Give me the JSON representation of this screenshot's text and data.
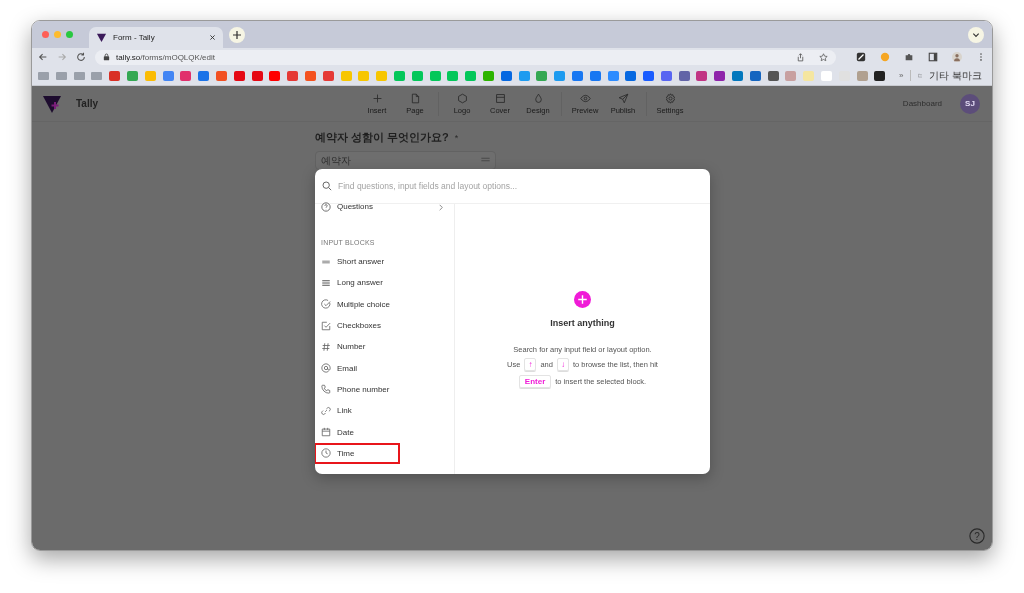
{
  "browser": {
    "tab_title": "Form - Tally",
    "url_host": "tally.so",
    "url_path": "/forms/mOQLQK/edit",
    "bookmarks_more": "»",
    "other_bookmarks": "기타 북마크"
  },
  "app": {
    "brand": "Tally",
    "toolbar_groups": [
      [
        {
          "label": "Insert",
          "kind": "plus"
        },
        {
          "label": "Page",
          "kind": "page"
        }
      ],
      [
        {
          "label": "Logo",
          "kind": "hexagon"
        },
        {
          "label": "Cover",
          "kind": "cover"
        },
        {
          "label": "Design",
          "kind": "drop"
        }
      ],
      [
        {
          "label": "Preview",
          "kind": "eye"
        },
        {
          "label": "Publish",
          "kind": "send"
        }
      ],
      [
        {
          "label": "Settings",
          "kind": "gear"
        }
      ]
    ],
    "dashboard": "Dashboard",
    "avatar": "SJ"
  },
  "form": {
    "question": "예약자 성함이 무엇인가요?",
    "required_mark": "*",
    "placeholder": "예약자"
  },
  "modal": {
    "search_placeholder": "Find questions, input fields and layout options...",
    "questions": "Questions",
    "group_title": "INPUT BLOCKS",
    "items": [
      {
        "label": "Short answer",
        "kind": "short",
        "highlighted": false
      },
      {
        "label": "Long answer",
        "kind": "long",
        "highlighted": false
      },
      {
        "label": "Multiple choice",
        "kind": "choice",
        "highlighted": false
      },
      {
        "label": "Checkboxes",
        "kind": "checkbox",
        "highlighted": false
      },
      {
        "label": "Number",
        "kind": "number",
        "highlighted": false
      },
      {
        "label": "Email",
        "kind": "email",
        "highlighted": false
      },
      {
        "label": "Phone number",
        "kind": "phone",
        "highlighted": false
      },
      {
        "label": "Link",
        "kind": "link",
        "highlighted": false
      },
      {
        "label": "Date",
        "kind": "date",
        "highlighted": false
      },
      {
        "label": "Time",
        "kind": "time",
        "highlighted": true
      }
    ],
    "empty_title": "Insert anything",
    "empty_line": "Search for any input field or layout option.",
    "hint_lines": [
      [
        {
          "kind": "text",
          "text": "Use"
        },
        {
          "kind": "key",
          "text": "↑"
        },
        {
          "kind": "text",
          "text": "and"
        },
        {
          "kind": "key",
          "text": "↓"
        },
        {
          "kind": "text",
          "text": "to browse the list, then hit"
        }
      ],
      [
        {
          "kind": "key",
          "text": "Enter"
        },
        {
          "kind": "text",
          "text": "to insert the selected block."
        }
      ]
    ]
  },
  "help": "?"
}
